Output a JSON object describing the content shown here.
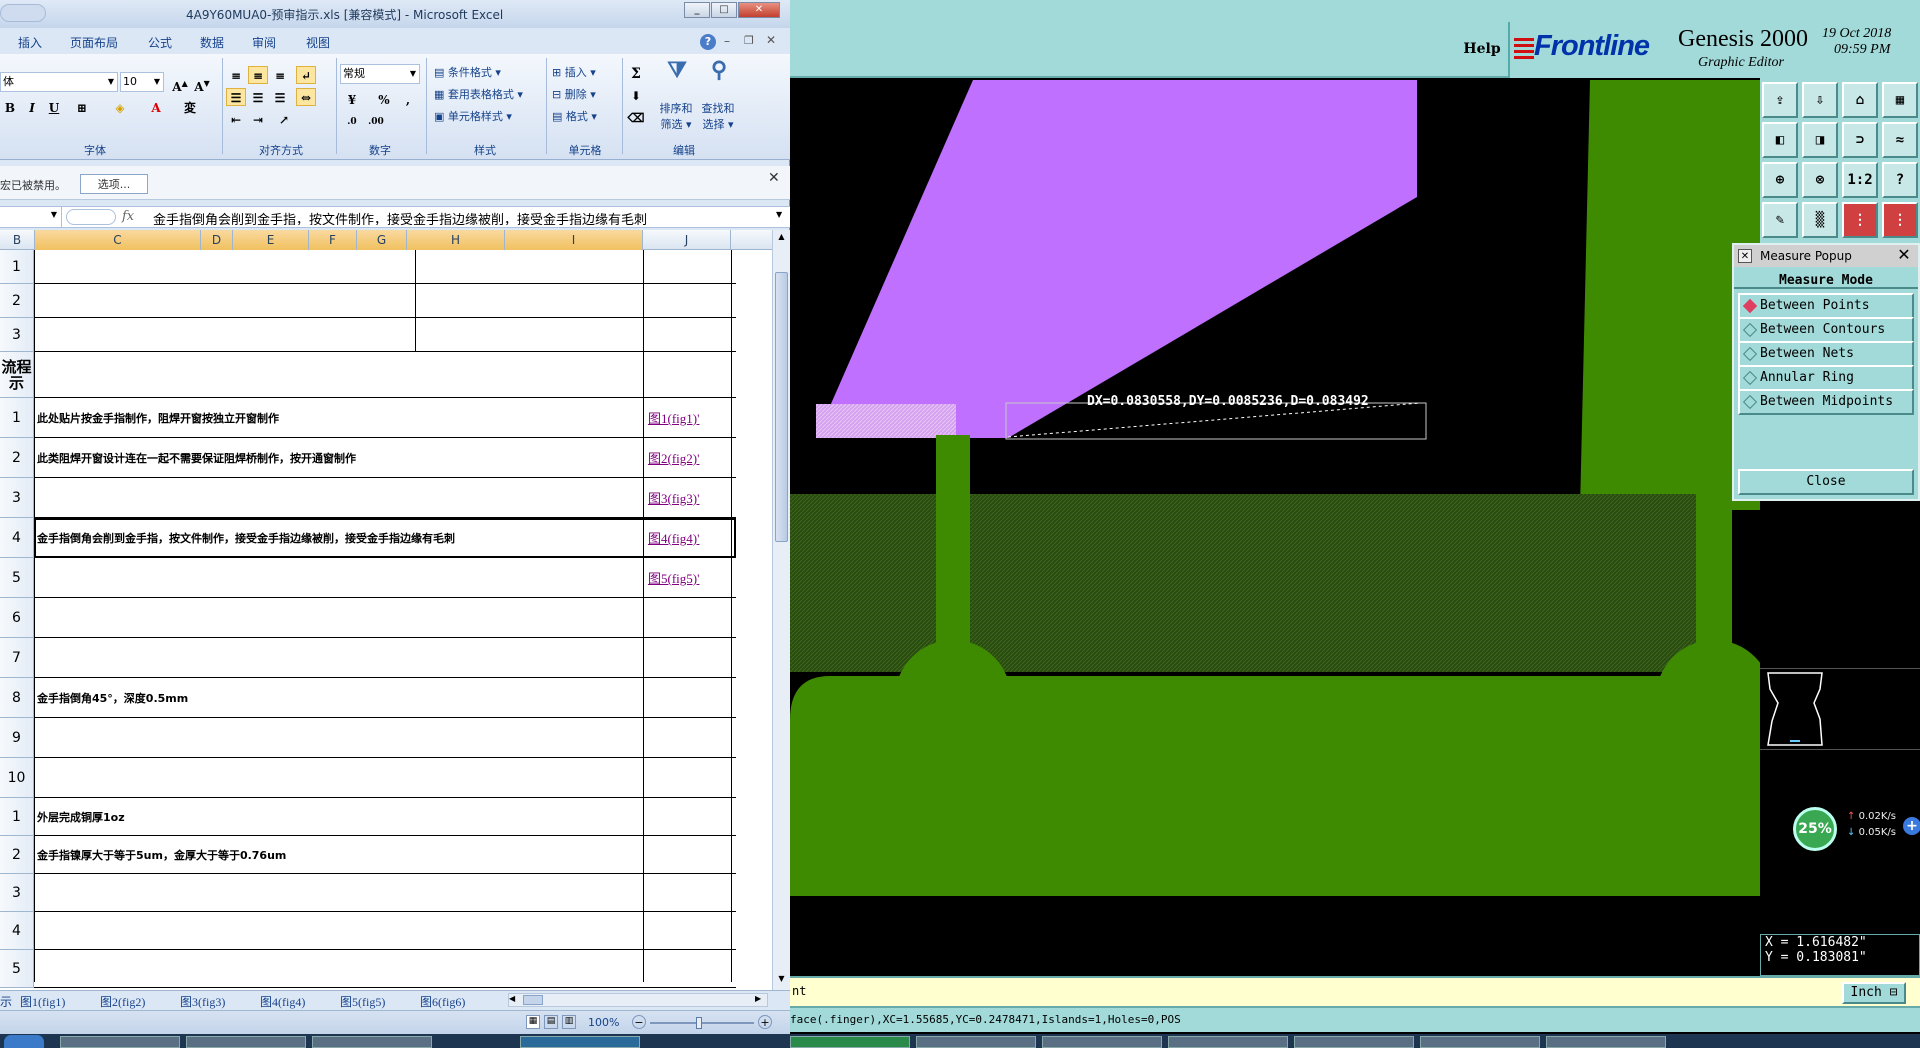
{
  "excel": {
    "title": "4A9Y60MUA0-预审指示.xls  [兼容模式] - Microsoft Excel",
    "tabs": [
      "插入",
      "页面布局",
      "公式",
      "数据",
      "审阅",
      "视图"
    ],
    "ribbon": {
      "font_name": "体",
      "font_size": "10",
      "number_format": "常规",
      "groups": [
        "字体",
        "对齐方式",
        "数字",
        "样式",
        "单元格",
        "编辑"
      ],
      "style_buttons": [
        "条件格式",
        "套用表格格式",
        "单元格样式"
      ],
      "cell_buttons": [
        "插入",
        "删除",
        "格式"
      ],
      "edit_buttons": [
        "排序和\n筛选",
        "查找和\n选择"
      ],
      "sort_label_1": "排序和",
      "sort_label_2": "筛选",
      "find_label_1": "查找和",
      "find_label_2": "选择",
      "bold": "B",
      "italic": "I",
      "underline": "U",
      "percent": "%",
      "comma": ","
    },
    "security": {
      "message": "宏已被禁用。",
      "options_button": "选项..."
    },
    "formula_bar": {
      "fx": "fx",
      "content": "金手指倒角会削到金手指，按文件制作，接受金手指边缘被削，接受金手指边缘有毛刺"
    },
    "columns": [
      "B",
      "C",
      "D",
      "E",
      "F",
      "G",
      "H",
      "I",
      "J"
    ],
    "rows": [
      {
        "num": "1",
        "text": "",
        "link": ""
      },
      {
        "num": "2",
        "text": "",
        "link": ""
      },
      {
        "num": "3",
        "text": "",
        "link": ""
      },
      {
        "num": "流程\n示",
        "text": "",
        "link": ""
      },
      {
        "num": "1",
        "text": "此处贴片按金手指制作，阻焊开窗按独立开窗制作",
        "link": "图1(fig1)'"
      },
      {
        "num": "2",
        "text": "此类阻焊开窗设计连在一起不需要保证阻焊桥制作，按开通窗制作",
        "link": "图2(fig2)'"
      },
      {
        "num": "3",
        "text": "",
        "link": "图3(fig3)'"
      },
      {
        "num": "4",
        "text": "金手指倒角会削到金手指，按文件制作，接受金手指边缘被削，接受金手指边缘有毛刺",
        "link": "图4(fig4)'"
      },
      {
        "num": "5",
        "text": "",
        "link": "图5(fig5)'"
      },
      {
        "num": "6",
        "text": "",
        "link": ""
      },
      {
        "num": "7",
        "text": "",
        "link": ""
      },
      {
        "num": "8",
        "text": "金手指倒角45°，深度0.5mm",
        "link": ""
      },
      {
        "num": "9",
        "text": "",
        "link": ""
      },
      {
        "num": "10",
        "text": "",
        "link": ""
      },
      {
        "num": "1",
        "text": "外层完成铜厚1oz",
        "link": ""
      },
      {
        "num": "2",
        "text": "金手指镍厚大于等于5um，金厚大于等于0.76um",
        "link": ""
      },
      {
        "num": "3",
        "text": "",
        "link": ""
      },
      {
        "num": "4",
        "text": "",
        "link": ""
      },
      {
        "num": "5",
        "text": "",
        "link": ""
      }
    ],
    "sheet_tabs": [
      "示",
      "图1(fig1)",
      "图2(fig2)",
      "图3(fig3)",
      "图4(fig4)",
      "图5(fig5)",
      "图6(fig6)"
    ],
    "zoom": "100%"
  },
  "genesis": {
    "help": "Help",
    "logo": "Frontline",
    "product": "Genesis 2000",
    "subtitle": "Graphic Editor",
    "date": "19 Oct 2018",
    "time": "09:59 PM",
    "measure_readout": "DX=0.0830558,DY=0.0085236,D=0.083492",
    "popup": {
      "title": "Measure Popup",
      "mode_label": "Measure Mode",
      "options": [
        {
          "label": "Between Points",
          "selected": true
        },
        {
          "label": "Between Contours",
          "selected": false
        },
        {
          "label": "Between Nets",
          "selected": false
        },
        {
          "label": "Annular Ring",
          "selected": false
        },
        {
          "label": "Between Midpoints",
          "selected": false
        }
      ],
      "close": "Close"
    },
    "icons": [
      "1:2",
      "?"
    ],
    "coords": {
      "x": "X = 1.616482\"",
      "y": "Y = 0.183081\""
    },
    "prompt": "nt",
    "units": "Inch",
    "status": "face(.finger),XC=1.55685,YC=0.2478471,Islands=1,Holes=0,POS",
    "net_widget": {
      "percent": "25%",
      "up": "0.02K/s",
      "down": "0.05K/s",
      "percent_value": 25
    },
    "colors": {
      "copper": "#3e8a00",
      "mask": "#c070ff",
      "background": "#000000",
      "panel": "#a2d9d9"
    }
  }
}
